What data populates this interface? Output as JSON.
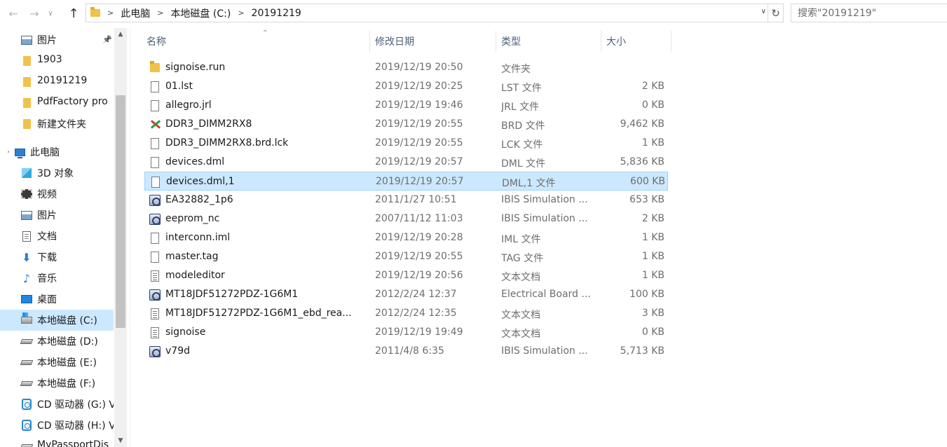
{
  "address_bar": {
    "crumbs": [
      "此电脑",
      "本地磁盘 (C:)",
      "20191219"
    ],
    "search_placeholder": "搜索\"20191219\""
  },
  "nav_pane": {
    "items": [
      {
        "label": "图片",
        "icon": "pictures-icon",
        "indent": 1,
        "pinned": true
      },
      {
        "label": "1903",
        "icon": "folder-icon",
        "indent": 1
      },
      {
        "label": "20191219",
        "icon": "folder-icon",
        "indent": 1
      },
      {
        "label": "PdfFactory pro",
        "icon": "folder-icon",
        "indent": 1
      },
      {
        "label": "新建文件夹",
        "icon": "folder-icon",
        "indent": 1
      },
      {
        "label": "此电脑",
        "icon": "computer-icon",
        "indent": 0
      },
      {
        "label": "3D 对象",
        "icon": "3d-objects-icon",
        "indent": 1
      },
      {
        "label": "视频",
        "icon": "videos-icon",
        "indent": 1
      },
      {
        "label": "图片",
        "icon": "pictures-icon",
        "indent": 1
      },
      {
        "label": "文档",
        "icon": "documents-icon",
        "indent": 1
      },
      {
        "label": "下载",
        "icon": "download-icon",
        "indent": 1
      },
      {
        "label": "音乐",
        "icon": "music-icon",
        "indent": 1
      },
      {
        "label": "桌面",
        "icon": "desktop-icon",
        "indent": 1
      },
      {
        "label": "本地磁盘 (C:)",
        "icon": "system-drive-icon",
        "indent": 1,
        "selected": true
      },
      {
        "label": "本地磁盘 (D:)",
        "icon": "drive-icon",
        "indent": 1
      },
      {
        "label": "本地磁盘 (E:)",
        "icon": "drive-icon",
        "indent": 1
      },
      {
        "label": "本地磁盘 (F:)",
        "icon": "drive-icon",
        "indent": 1
      },
      {
        "label": "CD 驱动器 (G:) V",
        "icon": "cd-drive-icon",
        "indent": 1
      },
      {
        "label": "CD 驱动器 (H:) V",
        "icon": "cd-drive-icon",
        "indent": 1
      },
      {
        "label": "MyPassportDis",
        "icon": "drive-icon",
        "indent": 1
      }
    ]
  },
  "columns": {
    "name": "名称",
    "date": "修改日期",
    "type": "类型",
    "size": "大小"
  },
  "files": [
    {
      "name": "signoise.run",
      "date": "2019/12/19 20:50",
      "type": "文件夹",
      "size": "",
      "icon": "folder-icon"
    },
    {
      "name": "01.lst",
      "date": "2019/12/19 20:25",
      "type": "LST 文件",
      "size": "2 KB",
      "icon": "file-icon"
    },
    {
      "name": "allegro.jrl",
      "date": "2019/12/19 19:46",
      "type": "JRL 文件",
      "size": "0 KB",
      "icon": "file-icon"
    },
    {
      "name": "DDR3_DIMM2RX8",
      "date": "2019/12/19 20:55",
      "type": "BRD 文件",
      "size": "9,462 KB",
      "icon": "board-file-icon"
    },
    {
      "name": "DDR3_DIMM2RX8.brd.lck",
      "date": "2019/12/19 20:55",
      "type": "LCK 文件",
      "size": "1 KB",
      "icon": "file-icon"
    },
    {
      "name": "devices.dml",
      "date": "2019/12/19 20:57",
      "type": "DML 文件",
      "size": "5,836 KB",
      "icon": "file-icon"
    },
    {
      "name": "devices.dml,1",
      "date": "2019/12/19 20:57",
      "type": "DML,1 文件",
      "size": "600 KB",
      "icon": "file-icon",
      "selected": true
    },
    {
      "name": "EA32882_1p6",
      "date": "2011/1/27 10:51",
      "type": "IBIS Simulation ...",
      "size": "653 KB",
      "icon": "ibis-file-icon"
    },
    {
      "name": "eeprom_nc",
      "date": "2007/11/12 11:03",
      "type": "IBIS Simulation ...",
      "size": "2 KB",
      "icon": "ibis-file-icon"
    },
    {
      "name": "interconn.iml",
      "date": "2019/12/19 20:28",
      "type": "IML 文件",
      "size": "1 KB",
      "icon": "file-icon"
    },
    {
      "name": "master.tag",
      "date": "2019/12/19 20:55",
      "type": "TAG 文件",
      "size": "1 KB",
      "icon": "file-icon"
    },
    {
      "name": "modeleditor",
      "date": "2019/12/19 20:56",
      "type": "文本文档",
      "size": "1 KB",
      "icon": "text-file-icon"
    },
    {
      "name": "MT18JDF51272PDZ-1G6M1",
      "date": "2012/2/24 12:37",
      "type": "Electrical Board ...",
      "size": "100 KB",
      "icon": "ibis-file-icon"
    },
    {
      "name": "MT18JDF51272PDZ-1G6M1_ebd_rea...",
      "date": "2012/2/24 12:35",
      "type": "文本文档",
      "size": "3 KB",
      "icon": "text-file-icon"
    },
    {
      "name": "signoise",
      "date": "2019/12/19 19:49",
      "type": "文本文档",
      "size": "0 KB",
      "icon": "text-file-icon"
    },
    {
      "name": "v79d",
      "date": "2011/4/8 6:35",
      "type": "IBIS Simulation ...",
      "size": "5,713 KB",
      "icon": "ibis-file-icon"
    }
  ]
}
